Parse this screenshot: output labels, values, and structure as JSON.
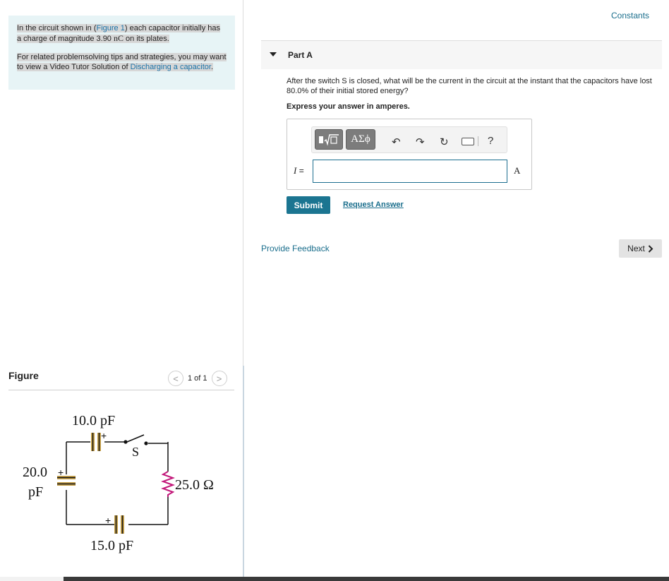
{
  "intro": {
    "p1_before": "In the circuit shown in (",
    "p1_link": "Figure 1",
    "p1_mid": ") each capacitor initially has a charge of magnitude 3.90 ",
    "p1_unit": "nC",
    "p1_after": " on its plates.",
    "p2_before": "For related problemsolving tips and strategies, you may want to view a Video Tutor Solution of ",
    "p2_link": "Discharging a capacitor",
    "p2_after": "."
  },
  "figure": {
    "title": "Figure",
    "pager_text": "1 of 1",
    "prev_glyph": "<",
    "next_glyph": ">",
    "circuit": {
      "c_top": "10.0 pF",
      "c_left_value": "20.0",
      "c_left_unit": "pF",
      "c_bottom": "15.0 pF",
      "resistor": "25.0 Ω",
      "switch": "S",
      "plus": "+"
    }
  },
  "header": {
    "constants_link": "Constants"
  },
  "part": {
    "title": "Part A",
    "question": "After the switch S is closed, what will be the current in the circuit at the instant that the capacitors have lost 80.0% of their initial stored energy?",
    "instruction": "Express your answer in amperes.",
    "variable": "I",
    "equals": "=",
    "unit": "A",
    "answer_value": "",
    "greek_button": "ΑΣϕ",
    "help_glyph": "?",
    "submit_label": "Submit",
    "request_label": "Request Answer"
  },
  "footer": {
    "feedback_label": "Provide Feedback",
    "next_label": "Next"
  }
}
